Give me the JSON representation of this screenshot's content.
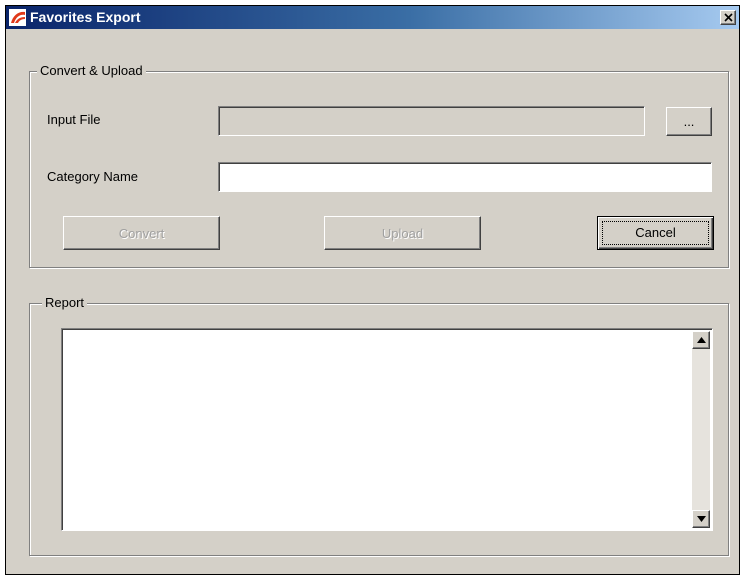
{
  "window": {
    "title": "Favorites Export",
    "icon": "app-logo-icon",
    "close_label": "×"
  },
  "convert_group": {
    "legend": "Convert & Upload",
    "input_file_label": "Input File",
    "input_file_value": "",
    "browse_label": "...",
    "category_name_label": "Category Name",
    "category_name_value": "",
    "convert_label": "Convert",
    "upload_label": "Upload",
    "cancel_label": "Cancel"
  },
  "report_group": {
    "legend": "Report",
    "content": ""
  },
  "colors": {
    "face": "#d4d0c8",
    "title_start": "#0a246a",
    "title_end": "#a6caf0",
    "logo": "#e0391a"
  }
}
